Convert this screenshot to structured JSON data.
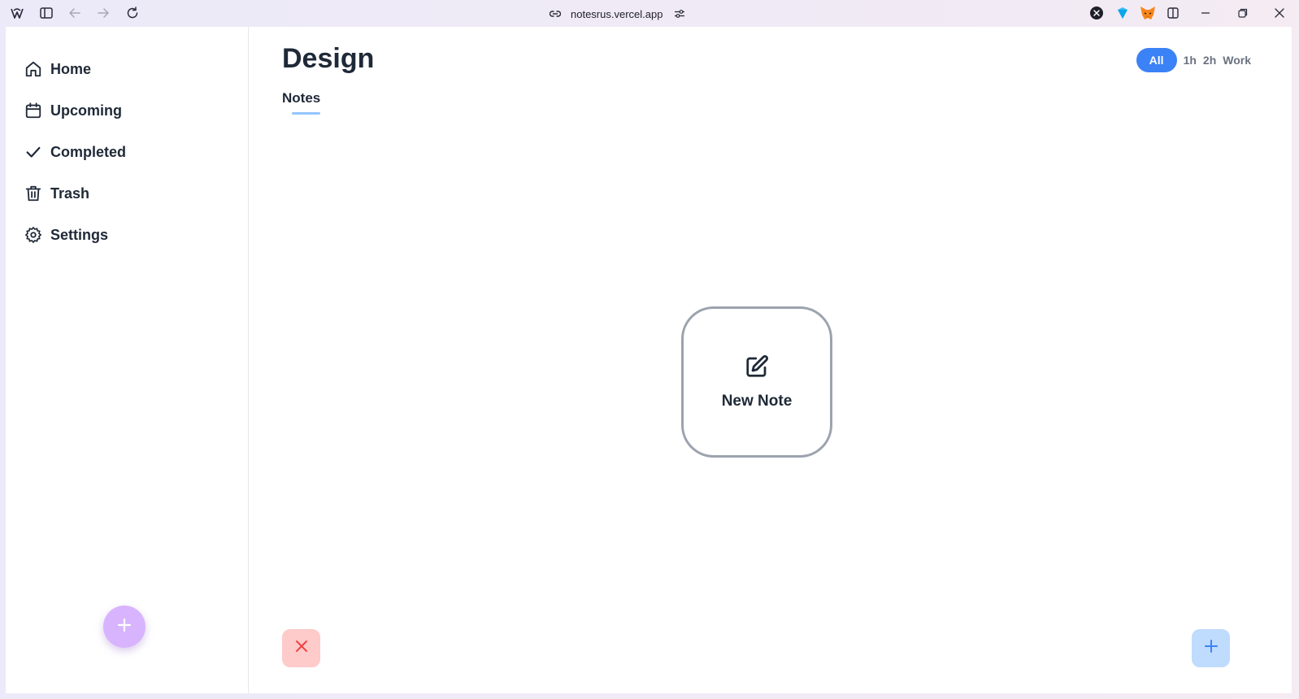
{
  "browser": {
    "url": "notesrus.vercel.app",
    "toolbar_icons": [
      "browser-logo-icon",
      "sidebar-toggle-icon",
      "back-icon",
      "forward-icon",
      "reload-icon"
    ],
    "extension_icons": [
      "x-extension-icon",
      "gem-extension-icon",
      "metamask-fox-icon",
      "split-view-icon"
    ],
    "window_controls": [
      "minimize-icon",
      "restore-icon",
      "close-icon"
    ]
  },
  "sidebar": {
    "items": [
      {
        "label": "Home",
        "icon": "home-icon"
      },
      {
        "label": "Upcoming",
        "icon": "calendar-icon"
      },
      {
        "label": "Completed",
        "icon": "check-icon"
      },
      {
        "label": "Trash",
        "icon": "trash-icon"
      },
      {
        "label": "Settings",
        "icon": "gear-icon"
      }
    ],
    "fab_icon": "plus-icon"
  },
  "main": {
    "title": "Design",
    "tabs": [
      {
        "label": "Notes",
        "active": true
      }
    ],
    "filters": [
      {
        "label": "All",
        "active": true
      },
      {
        "label": "1h",
        "active": false
      },
      {
        "label": "2h",
        "active": false
      },
      {
        "label": "Work",
        "active": false
      }
    ],
    "new_note": {
      "label": "New Note",
      "icon": "edit-icon"
    },
    "cancel_icon": "close-icon",
    "add_icon": "plus-icon"
  },
  "colors": {
    "accent_blue": "#3b82f6",
    "tab_underline": "#93c5fd",
    "fab_purple": "#d8b4fe",
    "cancel_bg": "#fecaca",
    "cancel_icon": "#ef4444",
    "add_bg": "#bfdbfe",
    "text_dark": "#1f2937"
  }
}
